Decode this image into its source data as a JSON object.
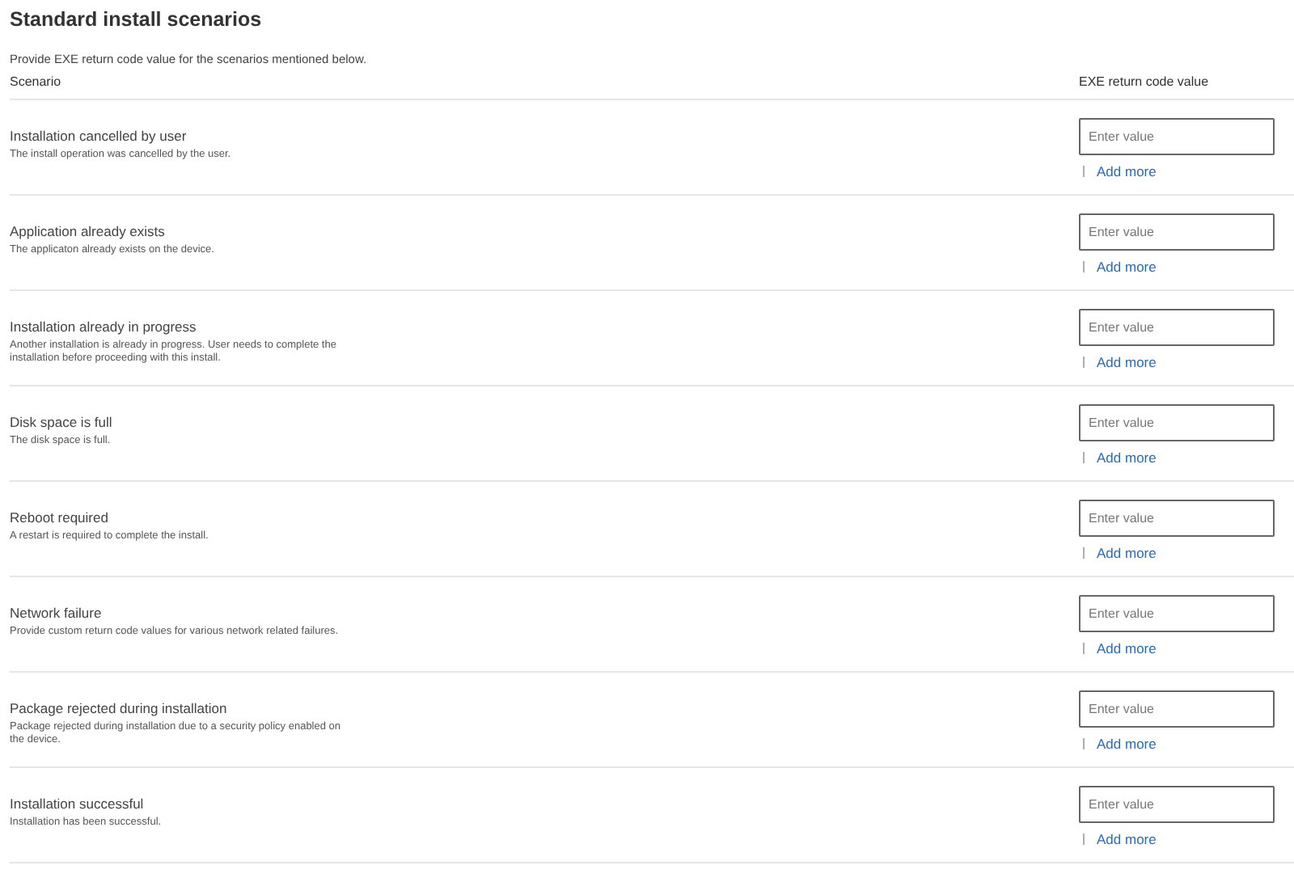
{
  "title": "Standard install scenarios",
  "subtitle": "Provide EXE return code value for the scenarios mentioned below.",
  "columns": [
    "Scenario",
    "EXE return code value"
  ],
  "rows": [
    {
      "name": "Installation cancelled by user",
      "description": "The install operation was cancelled by the user.",
      "placeholder": "Enter value",
      "add_label": "Add more"
    },
    {
      "name": "Application already exists",
      "description": "The applicaton already exists on the device.",
      "placeholder": "Enter value",
      "add_label": "Add more"
    },
    {
      "name": "Installation already in progress",
      "description": "Another installation is already in progress. User needs to complete the installation before proceeding with this install.",
      "placeholder": "Enter value",
      "add_label": "Add more"
    },
    {
      "name": "Disk space is full",
      "description": "The disk space is full.",
      "placeholder": "Enter value",
      "add_label": "Add more"
    },
    {
      "name": "Reboot required",
      "description": "A restart is required to complete the install.",
      "placeholder": "Enter value",
      "add_label": "Add more"
    },
    {
      "name": "Network failure",
      "description": "Provide custom return code values for various network related failures.",
      "placeholder": "Enter value",
      "add_label": "Add more"
    },
    {
      "name": "Package rejected during installation",
      "description": "Package rejected during installation due to a security policy enabled on the device.",
      "placeholder": "Enter value",
      "add_label": "Add more"
    },
    {
      "name": "Installation successful",
      "description": "Installation has been successful.",
      "placeholder": "Enter value",
      "add_label": "Add more"
    }
  ]
}
